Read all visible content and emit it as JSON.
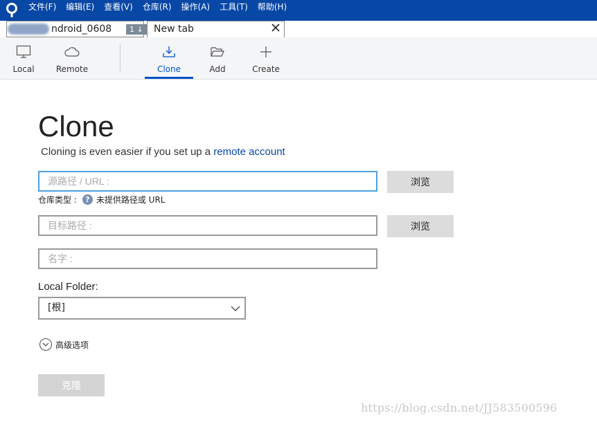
{
  "menubar": {
    "items": [
      "文件(F)",
      "编辑(E)",
      "查看(V)",
      "仓库(R)",
      "操作(A)",
      "工具(T)",
      "帮助(H)"
    ],
    "logo_icon": "sourcetree-logo-icon"
  },
  "tabs": [
    {
      "label": "ndroid_0608",
      "badge": "1 ↓",
      "active": false
    },
    {
      "label": "New tab",
      "active": true,
      "close_icon": "close-icon"
    }
  ],
  "add_tab_icon": "plus-icon",
  "toolbar": {
    "items": [
      {
        "label": "Local",
        "icon": "monitor-icon"
      },
      {
        "label": "Remote",
        "icon": "cloud-icon"
      },
      {
        "label": "Clone",
        "icon": "download-icon",
        "active": true
      },
      {
        "label": "Add",
        "icon": "folder-open-icon"
      },
      {
        "label": "Create",
        "icon": "plus-icon"
      }
    ]
  },
  "main": {
    "title": "Clone",
    "subtitle_prefix": "Cloning is even easier if you set up a ",
    "subtitle_link": "remote account",
    "source_placeholder": "源路径 / URL :",
    "source_value": "",
    "browse_label": "浏览",
    "repo_type_label": "仓库类型 :",
    "repo_type_value": "未提供路径或 URL",
    "help_icon": "?",
    "dest_placeholder": "目标路径 :",
    "dest_value": "",
    "name_placeholder": "名字 :",
    "name_value": "",
    "local_folder_label": "Local Folder:",
    "local_folder_value": "[根]",
    "advanced_label": "高级选项",
    "clone_button": "克隆"
  },
  "watermark": "https://blog.csdn.net/JJ583500596",
  "colors": {
    "menubar_bg": "#0747a6",
    "accent": "#0052cc",
    "focus_border": "#4da0e0",
    "toolbar_bg": "#f4f5f7"
  }
}
